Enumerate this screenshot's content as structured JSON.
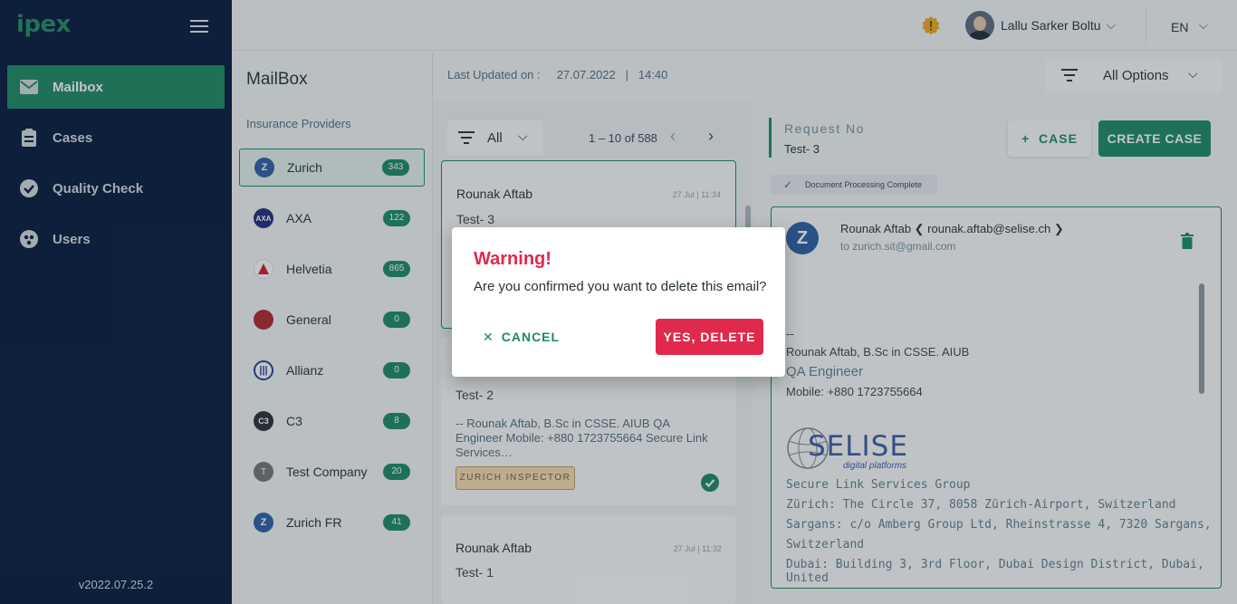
{
  "brand": {
    "logo": "ipex",
    "version": "v2022.07.25.2"
  },
  "nav": [
    {
      "label": "Mailbox",
      "icon": "mail-icon",
      "active": true
    },
    {
      "label": "Cases",
      "icon": "clipboard-icon",
      "active": false
    },
    {
      "label": "Quality Check",
      "icon": "check-circle-icon",
      "active": false
    },
    {
      "label": "Users",
      "icon": "users-icon",
      "active": false
    }
  ],
  "topbar": {
    "user_name": "Lallu Sarker Boltu",
    "language": "EN"
  },
  "mailbox": {
    "title": "MailBox",
    "subtitle": "Insurance Providers",
    "providers": [
      {
        "name": "Zurich",
        "count": "343",
        "active": true
      },
      {
        "name": "AXA",
        "count": "122",
        "active": false
      },
      {
        "name": "Helvetia",
        "count": "865",
        "active": false
      },
      {
        "name": "General",
        "count": "0",
        "active": false
      },
      {
        "name": "Allianz",
        "count": "0",
        "active": false
      },
      {
        "name": "C3",
        "count": "8",
        "active": false
      },
      {
        "name": "Test Company",
        "count": "20",
        "active": false
      },
      {
        "name": "Zurich FR",
        "count": "41",
        "active": false
      }
    ]
  },
  "header": {
    "last_updated_label": "Last Updated on :",
    "last_updated_date": "27.07.2022",
    "separator": "|",
    "last_updated_time": "14:40",
    "options_label": "All Options"
  },
  "list": {
    "filter_label": "All",
    "pagination": "1 – 10 of 588",
    "cards": [
      {
        "from": "Rounak Aftab",
        "date": "27 Jul | 11:34",
        "subject": "Test- 3"
      },
      {
        "subject": "Test- 2",
        "body": "-- Rounak Aftab, B.Sc in CSSE. AIUB QA Engineer Mobile: +880 1723755664 Secure Link Services…",
        "tag": "ZURICH INSPECTOR"
      },
      {
        "from": "Rounak Aftab",
        "date": "27 Jul | 11:32",
        "subject": "Test- 1"
      }
    ]
  },
  "detail": {
    "request_label": "Request No",
    "request_value": "Test- 3",
    "case_button": "CASE",
    "create_case_button": "CREATE CASE",
    "doc_status": "Document Processing Complete",
    "email": {
      "from": "Rounak Aftab ❮ rounak.aftab@selise.ch ❯",
      "to": "to zurich.sit@gmail.com",
      "body_lines": [
        "--",
        "Rounak Aftab, B.Sc in CSSE. AIUB",
        "QA Engineer",
        "Mobile: +880 1723755664",
        "Secure Link Services Group",
        "Zürich: The Circle 37, 8058 Zürich-Airport, Switzerland",
        "Sargans: c/o Amberg Group Ltd, Rheinstrasse 4, 7320 Sargans,",
        "Switzerland",
        "Dubai: Building 3, 3rd Floor, Dubai Design District, Dubai, United"
      ],
      "logo_text": "SELISE",
      "logo_subtext": "digital platforms"
    }
  },
  "modal": {
    "title": "Warning!",
    "message": "Are you confirmed you want to delete this email?",
    "cancel_label": "CANCEL",
    "delete_label": "YES, DELETE"
  },
  "colors": {
    "primary": "#1b8a62",
    "sidebar": "#04183a",
    "danger": "#e0294c",
    "tag_bg": "#f5dcb1"
  }
}
